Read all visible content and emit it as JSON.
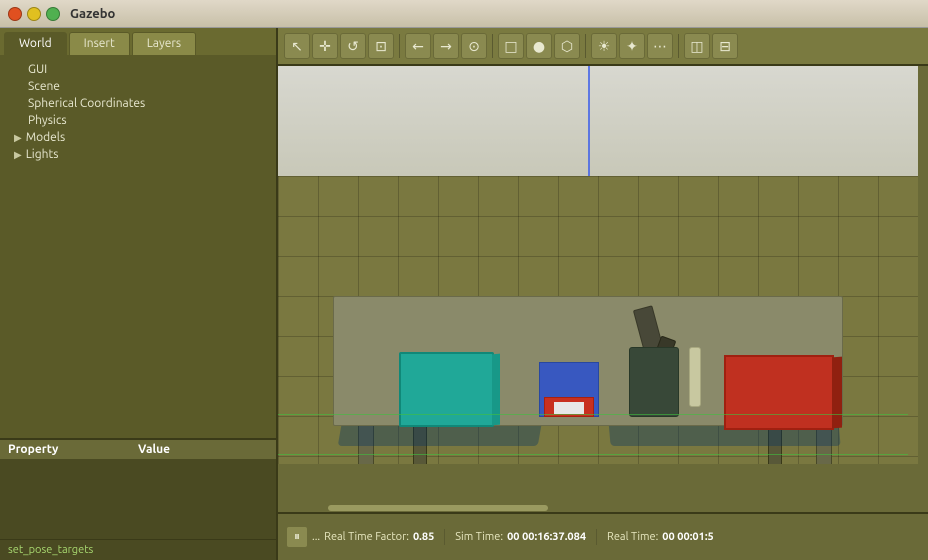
{
  "window": {
    "title": "Gazebo"
  },
  "tabs": [
    {
      "label": "World",
      "active": true
    },
    {
      "label": "Insert",
      "active": false
    },
    {
      "label": "Layers",
      "active": false
    }
  ],
  "sidebar_tree": {
    "items": [
      {
        "label": "GUI",
        "expandable": false
      },
      {
        "label": "Scene",
        "expandable": false
      },
      {
        "label": "Spherical Coordinates",
        "expandable": false
      },
      {
        "label": "Physics",
        "expandable": false
      },
      {
        "label": "Models",
        "expandable": true,
        "expanded": false
      },
      {
        "label": "Lights",
        "expandable": true,
        "expanded": false
      }
    ]
  },
  "property_panel": {
    "col1": "Property",
    "col2": "Value"
  },
  "bottom_label": "set_pose_targets",
  "toolbar": {
    "buttons": [
      {
        "icon": "↖",
        "name": "select-tool"
      },
      {
        "icon": "✛",
        "name": "move-tool"
      },
      {
        "icon": "↺",
        "name": "rotate-tool"
      },
      {
        "icon": "⊡",
        "name": "scale-tool"
      },
      {
        "icon": "←",
        "name": "undo"
      },
      {
        "icon": "→",
        "name": "redo"
      },
      {
        "icon": "⊙",
        "name": "snap"
      },
      {
        "icon": "□",
        "name": "shape-box"
      },
      {
        "icon": "○",
        "name": "shape-sphere"
      },
      {
        "icon": "⬡",
        "name": "shape-cylinder"
      },
      {
        "icon": "☀",
        "name": "light-point"
      },
      {
        "icon": "✦",
        "name": "light-directional"
      },
      {
        "icon": "⋯",
        "name": "light-spot"
      },
      {
        "icon": "◫",
        "name": "screenshot"
      },
      {
        "icon": "⊟",
        "name": "record"
      }
    ]
  },
  "status_bar": {
    "pause_icon": "⏸",
    "dots_icon": "...",
    "real_time_factor_label": "Real Time Factor:",
    "real_time_factor_value": "0.85",
    "sim_time_label": "Sim Time:",
    "sim_time_value": "00 00:16:37.084",
    "real_time_label": "Real Time:",
    "real_time_value": "00 00:01:5"
  }
}
